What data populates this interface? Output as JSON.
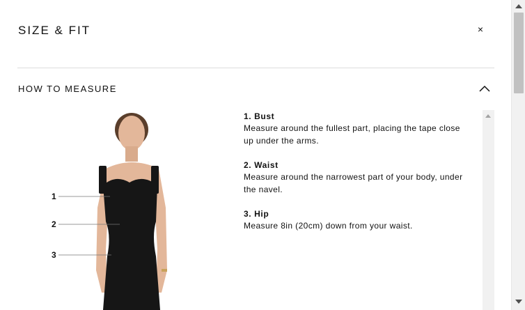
{
  "modal": {
    "title": "SIZE & FIT",
    "close_icon": "close-icon",
    "close_glyph": "×"
  },
  "section": {
    "title": "HOW TO MEASURE",
    "chevron_icon": "chevron-up-icon",
    "expanded": true
  },
  "figure": {
    "labels": [
      "1",
      "2",
      "3"
    ]
  },
  "measurements": [
    {
      "heading": "1. Bust",
      "description": "Measure around the fullest part, placing the tape close up under the arms."
    },
    {
      "heading": "2. Waist",
      "description": "Measure around the narrowest part of your body, under the navel."
    },
    {
      "heading": "3. Hip",
      "description": "Measure 8in (20cm) down from your waist."
    }
  ],
  "colors": {
    "dress": "#161616",
    "skin": "#e3b79a",
    "hair": "#5a3e2b"
  }
}
